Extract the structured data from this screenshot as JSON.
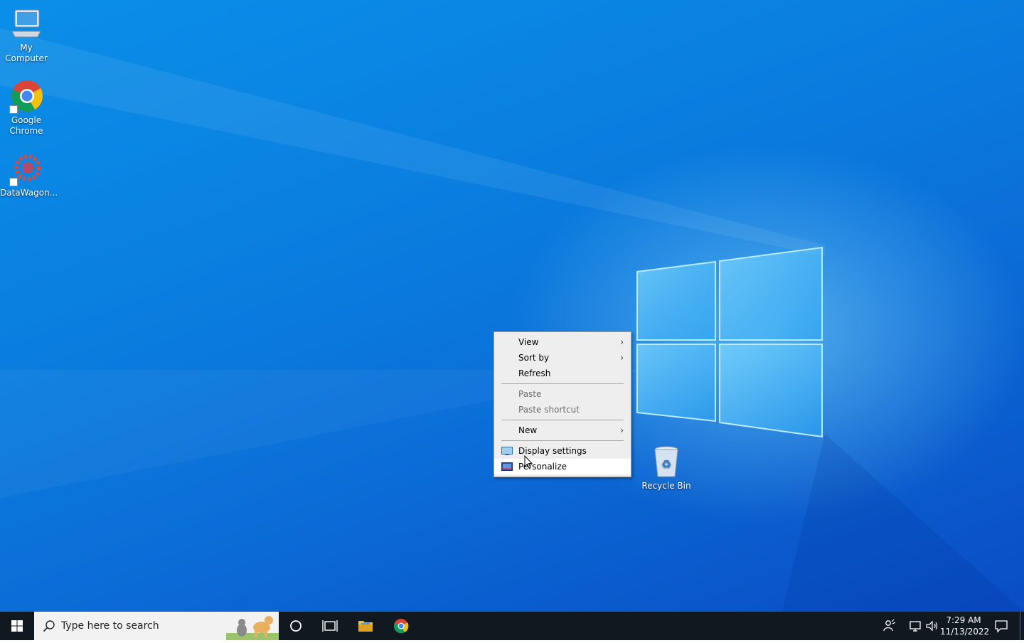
{
  "desktop": {
    "icons": [
      {
        "label": "My\nComputer",
        "label_line1": "My",
        "label_line2": "Computer"
      },
      {
        "label_line1": "Google",
        "label_line2": "Chrome"
      },
      {
        "label_line1": "DataWagon..."
      },
      {
        "label_line1": "Recycle Bin"
      }
    ]
  },
  "context_menu": {
    "items": [
      {
        "label": "View",
        "has_submenu": true
      },
      {
        "label": "Sort by",
        "has_submenu": true
      },
      {
        "label": "Refresh"
      },
      {
        "label": "Paste",
        "disabled": true
      },
      {
        "label": "Paste shortcut",
        "disabled": true
      },
      {
        "label": "New",
        "has_submenu": true
      },
      {
        "label": "Display settings"
      },
      {
        "label": "Personalize"
      }
    ],
    "arrow_glyph": "›"
  },
  "taskbar": {
    "search_placeholder": "Type here to search",
    "clock_time": "7:29 AM",
    "clock_date": "11/13/2022"
  },
  "colors": {
    "taskbar_bg": "#101820",
    "menu_bg": "#eeeeee",
    "desktop_blue": "#0a7fe0"
  },
  "icons": [
    "windows-start-icon",
    "search-icon",
    "cortana-icon",
    "task-view-icon",
    "file-explorer-icon",
    "chrome-icon",
    "people-icon",
    "network-icon",
    "volume-icon",
    "notifications-icon",
    "recycle-bin-icon",
    "computer-icon",
    "datawagon-icon"
  ]
}
